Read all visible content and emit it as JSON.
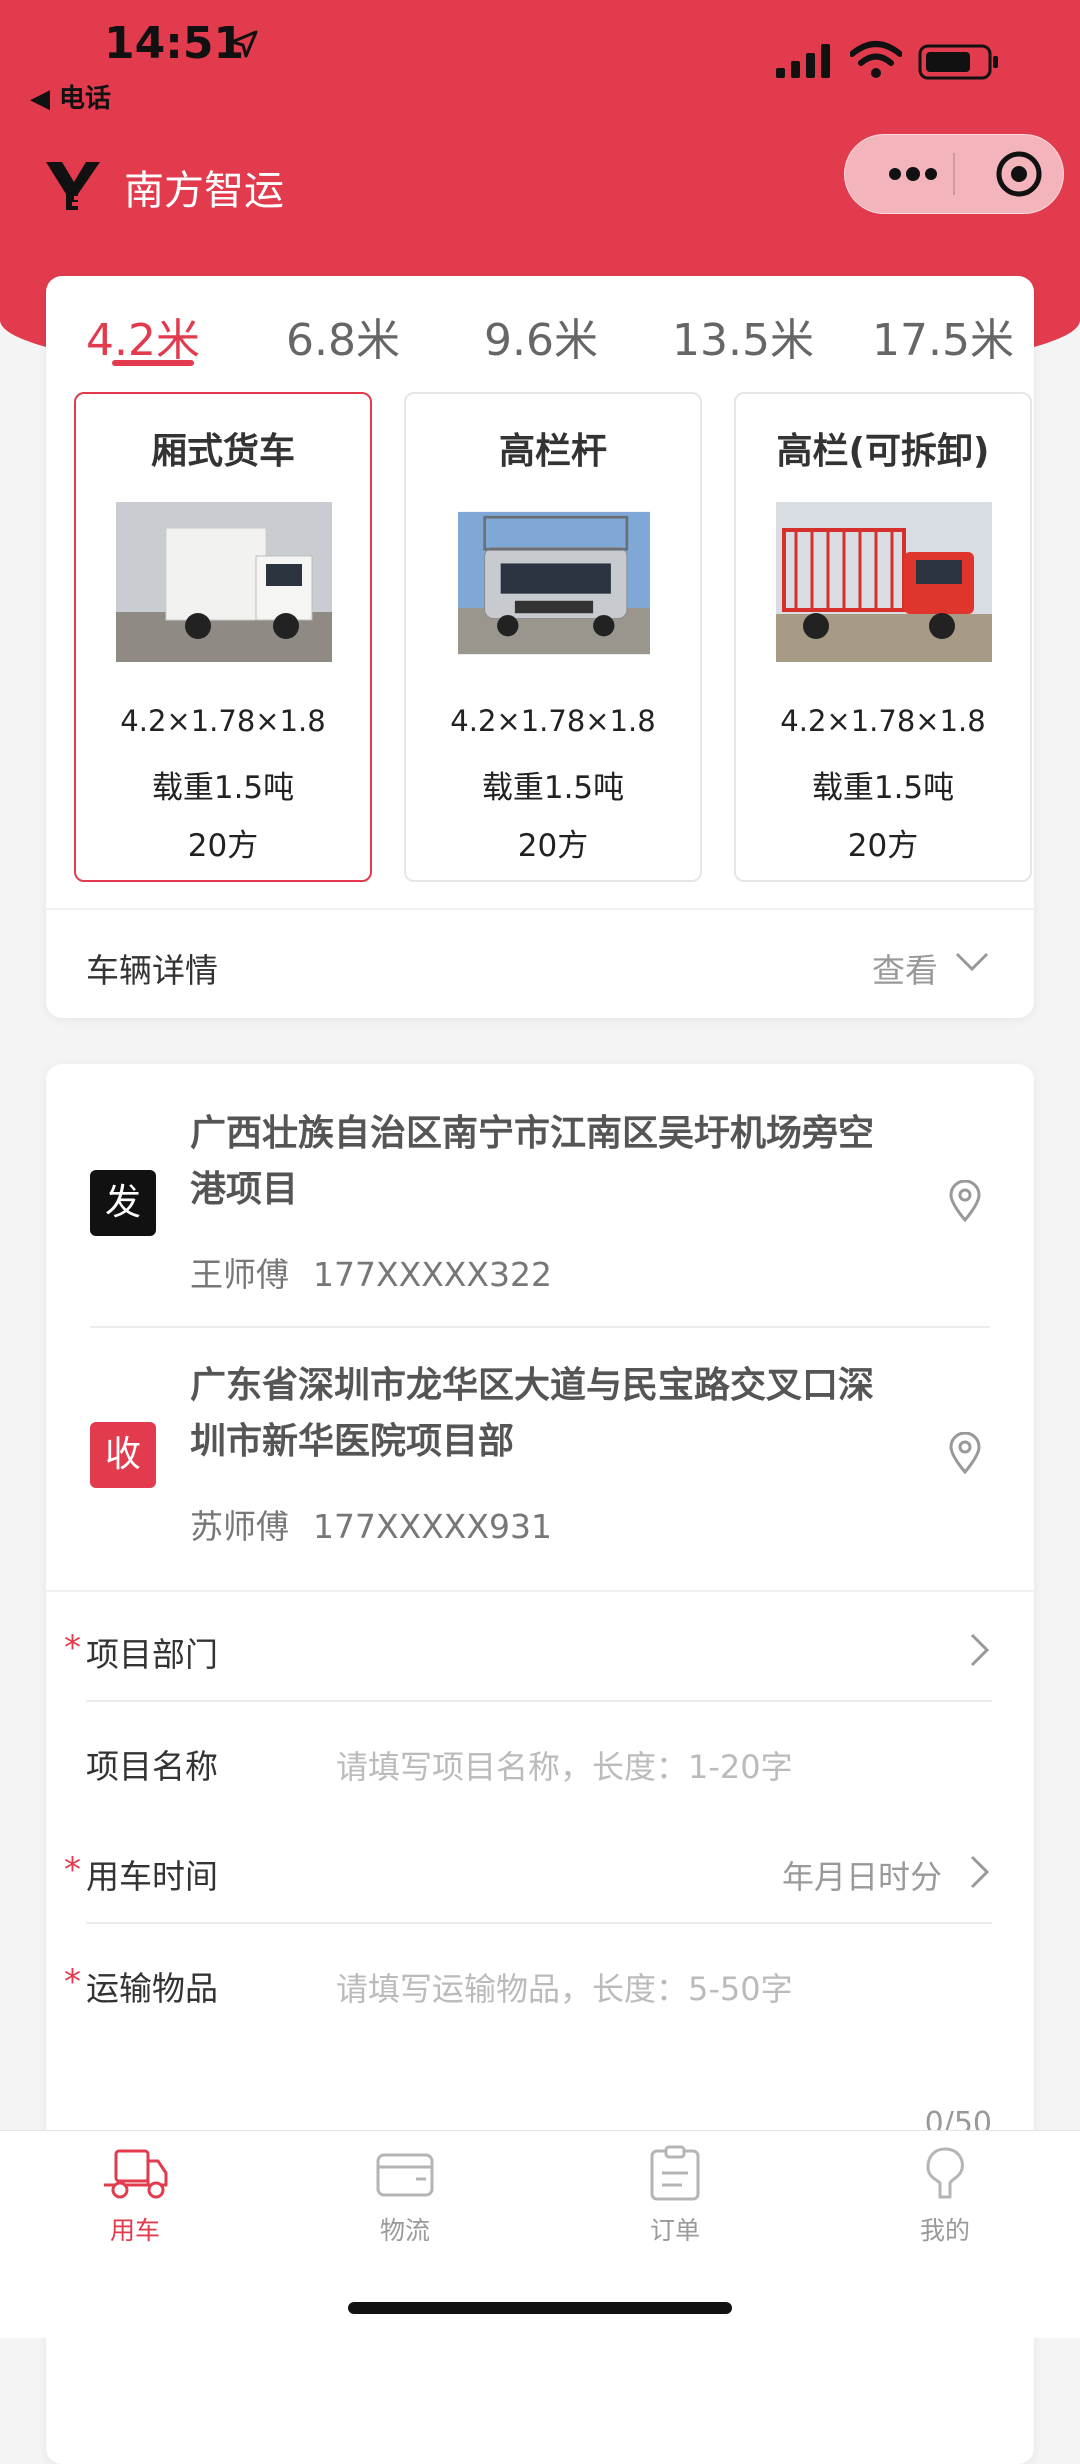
{
  "status_bar": {
    "time": "14:51",
    "back_label": "◀ 电话"
  },
  "app": {
    "title": "南方智运"
  },
  "length_tabs": [
    "4.2米",
    "6.8米",
    "9.6米",
    "13.5米",
    "17.5米"
  ],
  "active_tab_index": 0,
  "trucks": [
    {
      "name": "厢式货车",
      "dims": "4.2×1.78×1.8",
      "load": "载重1.5吨",
      "volume": "20方",
      "selected": true
    },
    {
      "name": "高栏杆",
      "dims": "4.2×1.78×1.8",
      "load": "载重1.5吨",
      "volume": "20方",
      "selected": false
    },
    {
      "name": "高栏(可拆卸)",
      "dims": "4.2×1.78×1.8",
      "load": "载重1.5吨",
      "volume": "20方",
      "selected": false
    }
  ],
  "vehicle_detail": {
    "label": "车辆详情",
    "action": "查看"
  },
  "sender": {
    "badge": "发",
    "address": "广西壮族自治区南宁市江南区吴圩机场旁空港项目",
    "name": "王师傅",
    "phone": "177XXXXX322",
    "badge_color": "#111111"
  },
  "receiver": {
    "badge": "收",
    "address": "广东省深圳市龙华区大道与民宝路交叉口深圳市新华医院项目部",
    "name": "苏师傅",
    "phone": "177XXXXX931",
    "badge_color": "#e23b4e"
  },
  "form": {
    "department": {
      "required_mark": "*",
      "label": "项目部门"
    },
    "project_name": {
      "label": "项目名称",
      "placeholder": "请填写项目名称，长度：1-20字"
    },
    "use_time": {
      "required_mark": "*",
      "label": "用车时间",
      "value": "年月日时分"
    },
    "goods": {
      "required_mark": "*",
      "label": "运输物品",
      "placeholder": "请填写运输物品，长度：5-50字",
      "counter": "0/50"
    }
  },
  "tabbar": [
    {
      "label": "用车",
      "icon": "truck-icon",
      "active": true
    },
    {
      "label": "物流",
      "icon": "wallet-icon",
      "active": false
    },
    {
      "label": "订单",
      "icon": "clipboard-icon",
      "active": false
    },
    {
      "label": "我的",
      "icon": "user-icon",
      "active": false
    }
  ],
  "colors": {
    "accent": "#e23b4e"
  }
}
